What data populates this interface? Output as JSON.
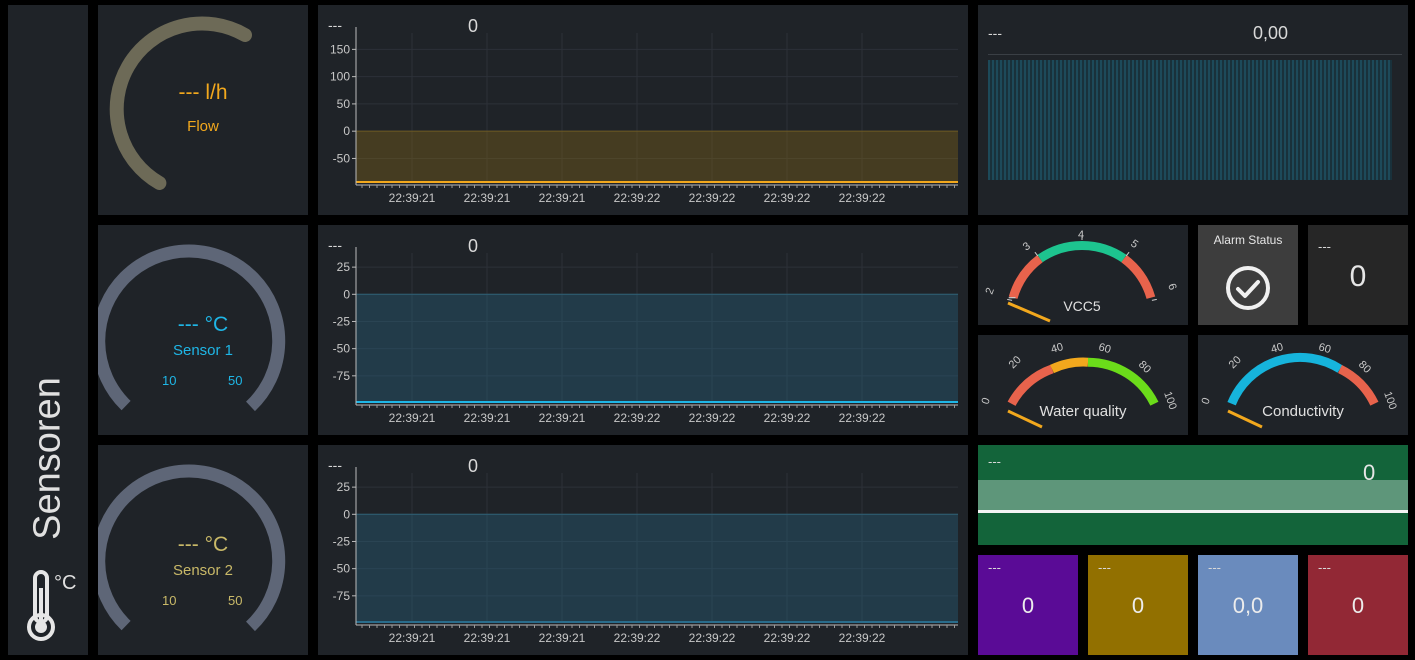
{
  "colors": {
    "background": "#000000",
    "tile": "#1f2328",
    "flow_accent": "#f2a81d",
    "sensor1_accent": "#1fb6e6",
    "sensor2_accent": "#c9b968",
    "alarm_bg": "#3d3d3d",
    "bar_green": "#13643a",
    "tile_purple": "#5a0b96",
    "tile_olive": "#927000",
    "tile_blue": "#6a8bbd",
    "tile_red": "#922835"
  },
  "sidebar": {
    "title": "Sensoren",
    "unit": "°C",
    "icon": "thermometer-icon"
  },
  "flow_gauge": {
    "value": "---",
    "unit": "l/h",
    "label": "Flow"
  },
  "sensor1_gauge": {
    "value": "---",
    "unit": "°C",
    "label": "Sensor 1",
    "min": "10",
    "max": "50"
  },
  "sensor2_gauge": {
    "value": "---",
    "unit": "°C",
    "label": "Sensor 2",
    "min": "10",
    "max": "50"
  },
  "time_ticks": [
    "22:39:21",
    "22:39:21",
    "22:39:21",
    "22:39:22",
    "22:39:22",
    "22:39:22",
    "22:39:22"
  ],
  "charts": [
    {
      "header": "---",
      "value": "0",
      "y_ticks": [
        "150",
        "100",
        "50",
        "0",
        "-50"
      ]
    },
    {
      "header": "---",
      "value": "0",
      "y_ticks": [
        "25",
        "0",
        "-25",
        "-50",
        "-75"
      ]
    },
    {
      "header": "---",
      "value": "0",
      "y_ticks": [
        "25",
        "0",
        "-25",
        "-50",
        "-75"
      ]
    }
  ],
  "chart_data": [
    {
      "type": "area",
      "title": "",
      "x": [
        "22:39:21",
        "22:39:21",
        "22:39:21",
        "22:39:22",
        "22:39:22",
        "22:39:22",
        "22:39:22"
      ],
      "y_ticks": [
        150,
        100,
        50,
        0,
        -50
      ],
      "ylim": [
        -95,
        180
      ],
      "fill_from": 0,
      "line_value": -95,
      "color": "#f2a81d"
    },
    {
      "type": "area",
      "title": "",
      "x": [
        "22:39:21",
        "22:39:21",
        "22:39:21",
        "22:39:22",
        "22:39:22",
        "22:39:22",
        "22:39:22"
      ],
      "y_ticks": [
        25,
        0,
        -25,
        -50,
        -75
      ],
      "ylim": [
        -100,
        38
      ],
      "fill_from": 0,
      "line_value": -100,
      "color": "#1fb6e6"
    },
    {
      "type": "area",
      "title": "",
      "x": [
        "22:39:21",
        "22:39:21",
        "22:39:21",
        "22:39:22",
        "22:39:22",
        "22:39:22",
        "22:39:22"
      ],
      "y_ticks": [
        25,
        0,
        -25,
        -50,
        -75
      ],
      "ylim": [
        -100,
        38
      ],
      "fill_from": 0,
      "line_value": -100,
      "color": "#2a6d8c"
    }
  ],
  "top_right": {
    "header": "---",
    "value": "0,00"
  },
  "vcc5": {
    "label": "VCC5",
    "ticks": [
      "2",
      "3",
      "4",
      "5",
      "6"
    ]
  },
  "alarm": {
    "title": "Alarm Status",
    "icon": "check-circle-icon"
  },
  "small_value": {
    "header": "---",
    "value": "0"
  },
  "water_quality": {
    "label": "Water quality",
    "ticks": [
      "0",
      "20",
      "40",
      "60",
      "80",
      "100"
    ]
  },
  "conductivity": {
    "label": "Conductivity",
    "ticks": [
      "0",
      "20",
      "40",
      "60",
      "80",
      "100"
    ]
  },
  "green_bar": {
    "header": "---",
    "value": "0"
  },
  "tiles": [
    {
      "header": "---",
      "value": "0"
    },
    {
      "header": "---",
      "value": "0"
    },
    {
      "header": "---",
      "value": "0,0"
    },
    {
      "header": "---",
      "value": "0"
    }
  ]
}
